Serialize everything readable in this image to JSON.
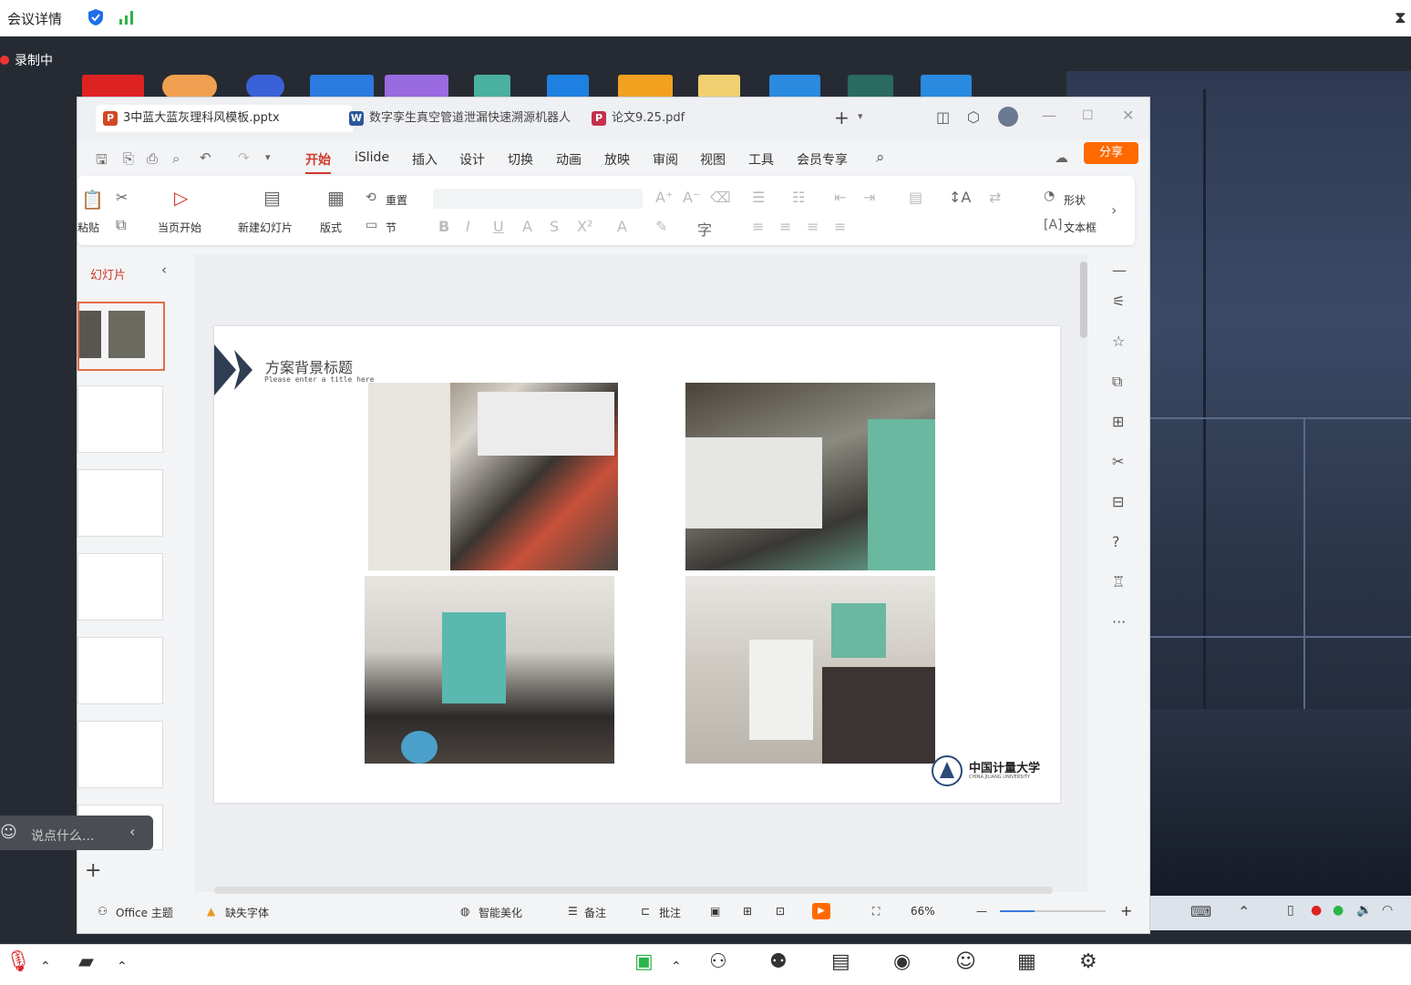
{
  "meeting": {
    "title": "会议详情",
    "recording": "录制中",
    "chat_placeholder": "说点什么...",
    "accent": "#ff6a00"
  },
  "wps": {
    "tabs": [
      {
        "label": "3中蓝大蓝灰理科风模板.pptx",
        "icon": "P",
        "color": "#d24726"
      },
      {
        "label": "数字孪生真空管道泄漏快速溯源机器人",
        "icon": "W",
        "color": "#2b579a"
      },
      {
        "label": "论文9.25.pdf",
        "icon": "P",
        "color": "#c4314b"
      }
    ],
    "menus": [
      "开始",
      "iSlide",
      "插入",
      "设计",
      "切换",
      "动画",
      "放映",
      "审阅",
      "视图",
      "工具",
      "会员专享"
    ],
    "share_label": "分享",
    "ribbon": {
      "paste": "粘贴",
      "from_current": "当页开始",
      "new_slide": "新建幻灯片",
      "layout": "版式",
      "reset": "重置",
      "section": "节",
      "shape": "形状",
      "textbox": "文本框"
    },
    "panel_title": "幻灯片",
    "slide": {
      "title": "方案背景标题",
      "subtitle": "Please enter a title here",
      "logo": "中国计量大学",
      "logo_sub": "CHINA JILIANG UNIVERSITY"
    },
    "status": {
      "theme": "Office 主题",
      "missing_font": "缺失字体",
      "beautify": "智能美化",
      "notes": "备注",
      "comments": "批注",
      "zoom": "66%"
    }
  }
}
